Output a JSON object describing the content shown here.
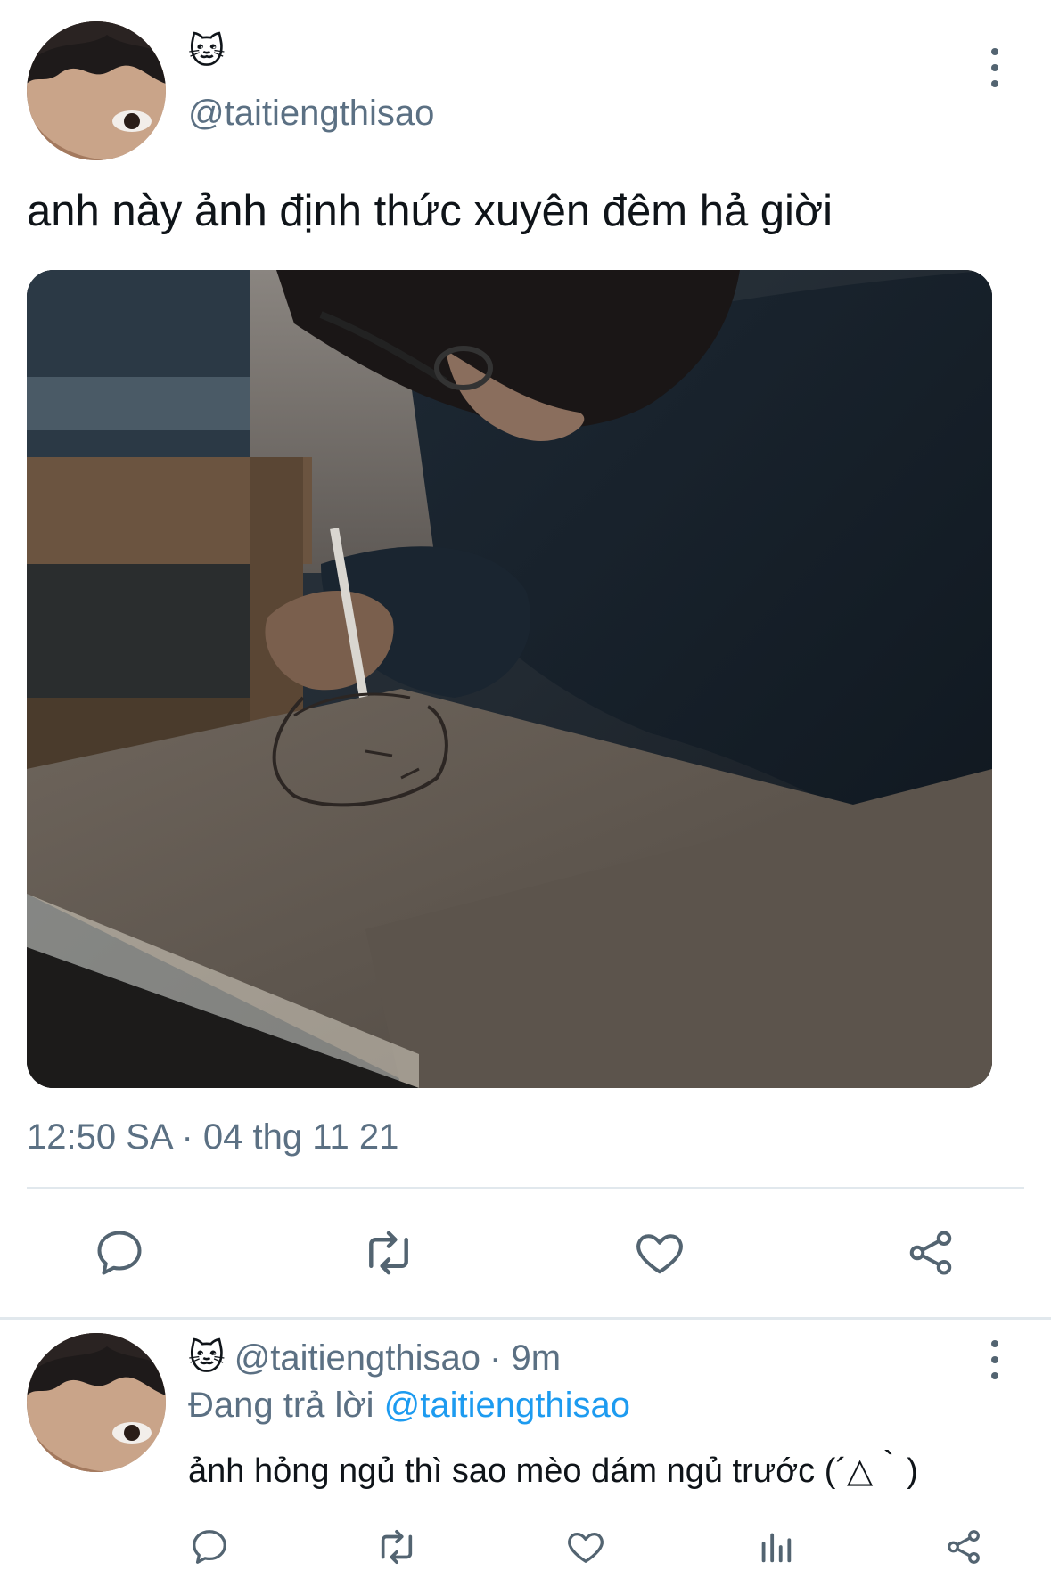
{
  "tweet": {
    "author_emoji": "🐱",
    "handle": "@taitiengthisao",
    "text": "anh này ảnh định thức xuyên đêm hả giời",
    "timestamp": "12:50 SA · 04 thg 11 21",
    "actions": [
      "reply-icon",
      "retweet-icon",
      "like-icon",
      "share-icon"
    ]
  },
  "reply": {
    "author_emoji": "🐱",
    "handle": "@taitiengthisao",
    "time": "· 9m",
    "replying_prefix": "Đang trả lời",
    "replying_to": "@taitiengthisao",
    "text": "ảnh hỏng ngủ thì sao mèo dám ngủ trước (´△｀)",
    "actions": [
      "reply-icon",
      "retweet-icon",
      "like-icon",
      "analytics-icon",
      "share-icon"
    ]
  },
  "colors": {
    "secondary_text": "#5b7083",
    "icon": "#536471",
    "link": "#1d9bf0",
    "divider": "#e1e8ed"
  }
}
